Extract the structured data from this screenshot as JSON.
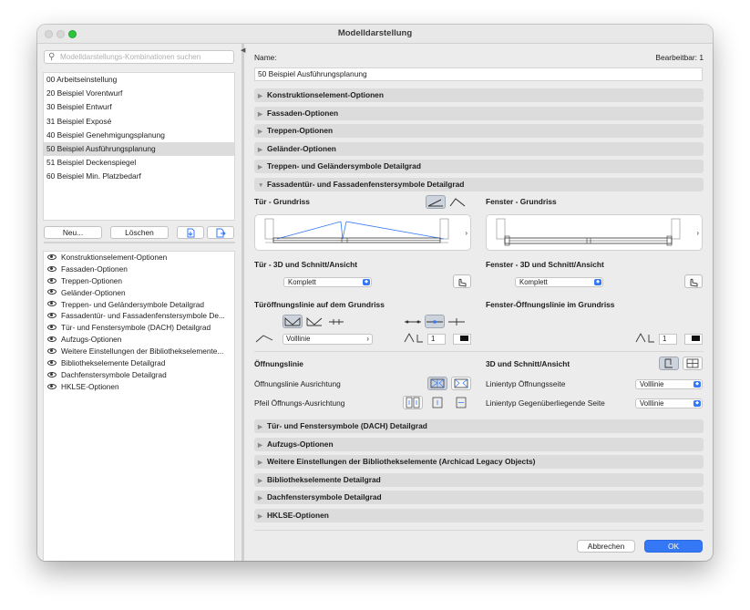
{
  "window": {
    "title": "Modelldarstellung"
  },
  "search": {
    "placeholder": "Modelldarstellungs-Kombinationen suchen",
    "value": ""
  },
  "combinations": [
    {
      "label": "00 Arbeitseinstellung",
      "selected": false
    },
    {
      "label": "20 Beispiel Vorentwurf",
      "selected": false
    },
    {
      "label": "30 Beispiel Entwurf",
      "selected": false
    },
    {
      "label": "31 Beispiel Exposé",
      "selected": false
    },
    {
      "label": "40 Beispiel Genehmigungsplanung",
      "selected": false
    },
    {
      "label": "50 Beispiel Ausführungsplanung",
      "selected": true
    },
    {
      "label": "51 Beispiel Deckenspiegel",
      "selected": false
    },
    {
      "label": "60 Beispiel Min. Platzbedarf",
      "selected": false
    }
  ],
  "buttons": {
    "new": "Neu...",
    "delete": "Löschen",
    "cancel": "Abbrechen",
    "ok": "OK"
  },
  "option_list": [
    "Konstruktionselement-Optionen",
    "Fassaden-Optionen",
    "Treppen-Optionen",
    "Geländer-Optionen",
    "Treppen- und Geländersymbole Detailgrad",
    "Fassadentür- und Fassadenfenstersymbole De...",
    "Tür- und Fenstersymbole (DACH) Detailgrad",
    "Aufzugs-Optionen",
    "Weitere Einstellungen der Bibliothekselemente...",
    "Bibliothekselemente Detailgrad",
    "Dachfenstersymbole Detailgrad",
    "HKLSE-Optionen"
  ],
  "name": {
    "label": "Name:",
    "value": "50 Beispiel Ausführungsplanung",
    "editable": "Bearbeitbar: 1"
  },
  "sections_top": [
    "Konstruktionselement-Optionen",
    "Fassaden-Optionen",
    "Treppen-Optionen",
    "Geländer-Optionen",
    "Treppen- und Geländersymbole Detailgrad"
  ],
  "expanded_section": "Fassadentür- und Fassadenfenstersymbole Detailgrad",
  "door": {
    "plan_label": "Tür - Grundriss",
    "section_label": "Tür - 3D und Schnitt/Ansicht",
    "section_value": "Komplett",
    "opening_label": "Türöffnungslinie auf dem Grundriss",
    "linetype_value": "Volllinie",
    "pen_value": "1"
  },
  "window_opt": {
    "plan_label": "Fenster - Grundriss",
    "section_label": "Fenster - 3D und Schnitt/Ansicht",
    "section_value": "Komplett",
    "opening_label": "Fenster-Öffnungslinie im Grundriss",
    "pen_value": "1"
  },
  "opening": {
    "title": "Öffnungslinie",
    "direction_label": "Öffnungslinie Ausrichtung",
    "arrow_label": "Pfeil Öffnungs-Ausrichtung"
  },
  "view3d": {
    "title": "3D und Schnitt/Ansicht",
    "side_label": "Linientyp Öffnungsseite",
    "side_value": "Volllinie",
    "opposite_label": "Linientyp Gegenüberliegende Seite",
    "opposite_value": "Volllinie"
  },
  "sections_bottom": [
    "Tür- und Fenstersymbole (DACH) Detailgrad",
    "Aufzugs-Optionen",
    "Weitere Einstellungen der Bibliothekselemente (Archicad Legacy Objects)",
    "Bibliothekselemente Detailgrad",
    "Dachfenstersymbole Detailgrad",
    "HKLSE-Optionen"
  ],
  "colors": {
    "accent": "#3478f6",
    "selection": "#dcdcdc",
    "section_bar": "#dcdcdc"
  }
}
